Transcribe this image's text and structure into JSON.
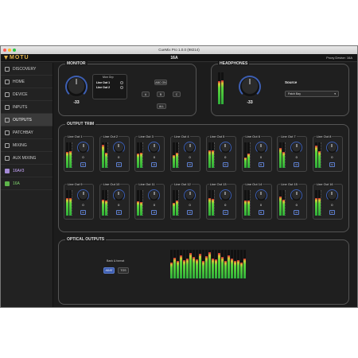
{
  "window_title": "CueMix Pro 1.0.0 (98214)",
  "app": {
    "logo": "MOTU",
    "device_name": "16A",
    "proxy": "Proxy Device: 16A"
  },
  "sidebar": {
    "items": [
      {
        "label": "DISCOVERY",
        "icon": "discovery-icon"
      },
      {
        "label": "HOME",
        "icon": "home-icon"
      },
      {
        "label": "DEVICE",
        "icon": "device-icon"
      },
      {
        "label": "INPUTS",
        "icon": "inputs-icon"
      },
      {
        "label": "OUTPUTS",
        "icon": "outputs-icon",
        "active": true
      },
      {
        "label": "PATCHBAY",
        "icon": "patchbay-icon"
      },
      {
        "label": "MIXING",
        "icon": "mixing-icon"
      },
      {
        "label": "AUX MIXING",
        "icon": "aux-mixing-icon"
      },
      {
        "label": "16A#3",
        "icon": "device-purple-icon"
      },
      {
        "label": "16A",
        "icon": "device-green-icon"
      }
    ]
  },
  "monitor": {
    "title": "MONITOR",
    "value": "-33",
    "mon_grp_label": "Mon Grp",
    "outputs": [
      "Line Out 1",
      "Line Out 2"
    ],
    "buttons": {
      "abc_on": "ABC ON",
      "a": "A",
      "b": "B",
      "c": "C",
      "all": "ALL"
    }
  },
  "headphones": {
    "title": "HEADPHONES",
    "value": "-33",
    "source_label": "Source",
    "source_value": "Patch Bay",
    "meter_levels": [
      0.72,
      0.75
    ]
  },
  "output_trim": {
    "title": "OUTPUT TRIM",
    "channels": [
      {
        "label": "Line Out 1",
        "value": "0",
        "levels": [
          0.62,
          0.66
        ]
      },
      {
        "label": "Line Out 2",
        "value": "0",
        "levels": [
          0.9,
          0.6
        ]
      },
      {
        "label": "Line Out 3",
        "value": "0",
        "levels": [
          0.55,
          0.58
        ]
      },
      {
        "label": "Line Out 4",
        "value": "0",
        "levels": [
          0.5,
          0.6
        ]
      },
      {
        "label": "Line Out 5",
        "value": "0",
        "levels": [
          0.68,
          0.7
        ]
      },
      {
        "label": "Line Out 6",
        "value": "0",
        "levels": [
          0.4,
          0.55
        ]
      },
      {
        "label": "Line Out 7",
        "value": "0",
        "levels": [
          0.78,
          0.62
        ]
      },
      {
        "label": "Line Out 8",
        "value": "0",
        "levels": [
          0.88,
          0.66
        ]
      },
      {
        "label": "Line Out 9",
        "value": "0",
        "levels": [
          0.68,
          0.7
        ]
      },
      {
        "label": "Line Out 10",
        "value": "0",
        "levels": [
          0.62,
          0.6
        ]
      },
      {
        "label": "Line Out 11",
        "value": "0",
        "levels": [
          0.55,
          0.52
        ]
      },
      {
        "label": "Line Out 12",
        "value": "0",
        "levels": [
          0.5,
          0.6
        ]
      },
      {
        "label": "Line Out 13",
        "value": "0",
        "levels": [
          0.7,
          0.66
        ]
      },
      {
        "label": "Line Out 14",
        "value": "0",
        "levels": [
          0.6,
          0.58
        ]
      },
      {
        "label": "Line Out 15",
        "value": "0",
        "levels": [
          0.76,
          0.62
        ]
      },
      {
        "label": "Line Out 16",
        "value": "0",
        "levels": [
          0.7,
          0.68
        ]
      }
    ],
    "mute_label": "M"
  },
  "optical_outputs": {
    "title": "OPTICAL OUTPUTS",
    "bank_label": "Bank & format",
    "buttons": [
      "ADAT",
      "TOS"
    ],
    "active_button": "ADAT",
    "meter_levels": [
      0.55,
      0.72,
      0.6,
      0.8,
      0.65,
      0.7,
      0.9,
      0.75,
      0.68,
      0.85,
      0.6,
      0.78,
      0.92,
      0.7,
      0.66,
      0.88,
      0.74,
      0.62,
      0.8,
      0.7,
      0.6,
      0.65,
      0.55,
      0.7
    ]
  }
}
